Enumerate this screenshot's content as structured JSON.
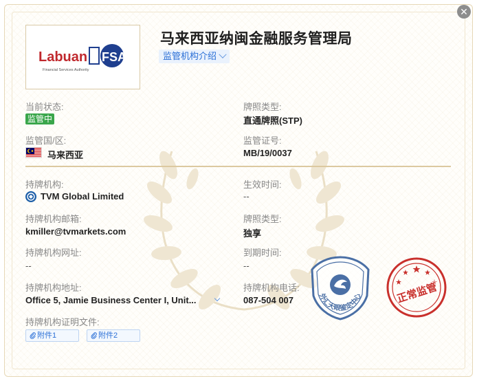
{
  "header": {
    "title": "马来西亚纳闽金融服务管理局",
    "intro_label": "监管机构介绍",
    "logo_main": "Labuan",
    "logo_badge": "FSA",
    "logo_sub": "Financial Services Authority"
  },
  "status": {
    "label": "当前状态:",
    "value": "监管中",
    "color": "#3aa64b"
  },
  "license_type_top": {
    "label": "牌照类型:",
    "value": "直通牌照(STP)"
  },
  "country": {
    "label": "监管国/区:",
    "value": "马来西亚"
  },
  "license_no": {
    "label": "监管证号:",
    "value": "MB/19/0037"
  },
  "holder": {
    "label": "持牌机构:",
    "value": "TVM Global Limited"
  },
  "effective_date": {
    "label": "生效时间:",
    "value": "--"
  },
  "holder_email": {
    "label": "持牌机构邮箱:",
    "value": "kmiller@tvmarkets.com"
  },
  "license_type": {
    "label": "牌照类型:",
    "value": "独享"
  },
  "holder_website": {
    "label": "持牌机构网址:",
    "value": "--"
  },
  "expiry_date": {
    "label": "到期时间:",
    "value": "--"
  },
  "holder_address": {
    "label": "持牌机构地址:",
    "value": "Office 5, Jamie Business Center I, Unit..."
  },
  "holder_phone": {
    "label": "持牌机构电话:",
    "value": "087-504 007"
  },
  "documents": {
    "label": "持牌机构证明文件:",
    "items": [
      "附件1",
      "附件2"
    ]
  },
  "seals": {
    "blue_text": "外汇天眼鉴定中心",
    "red_text": "正常监管"
  },
  "colors": {
    "accent_blue": "#2a6fd6",
    "gold_border": "#dcc9a0",
    "seal_blue": "#4a6fa5",
    "seal_red": "#c9302c"
  },
  "icons": {
    "close": "close-icon",
    "attachment": "paperclip-icon",
    "flag": "malaysia-flag-icon",
    "holder_logo": "tvm-logo-icon"
  }
}
